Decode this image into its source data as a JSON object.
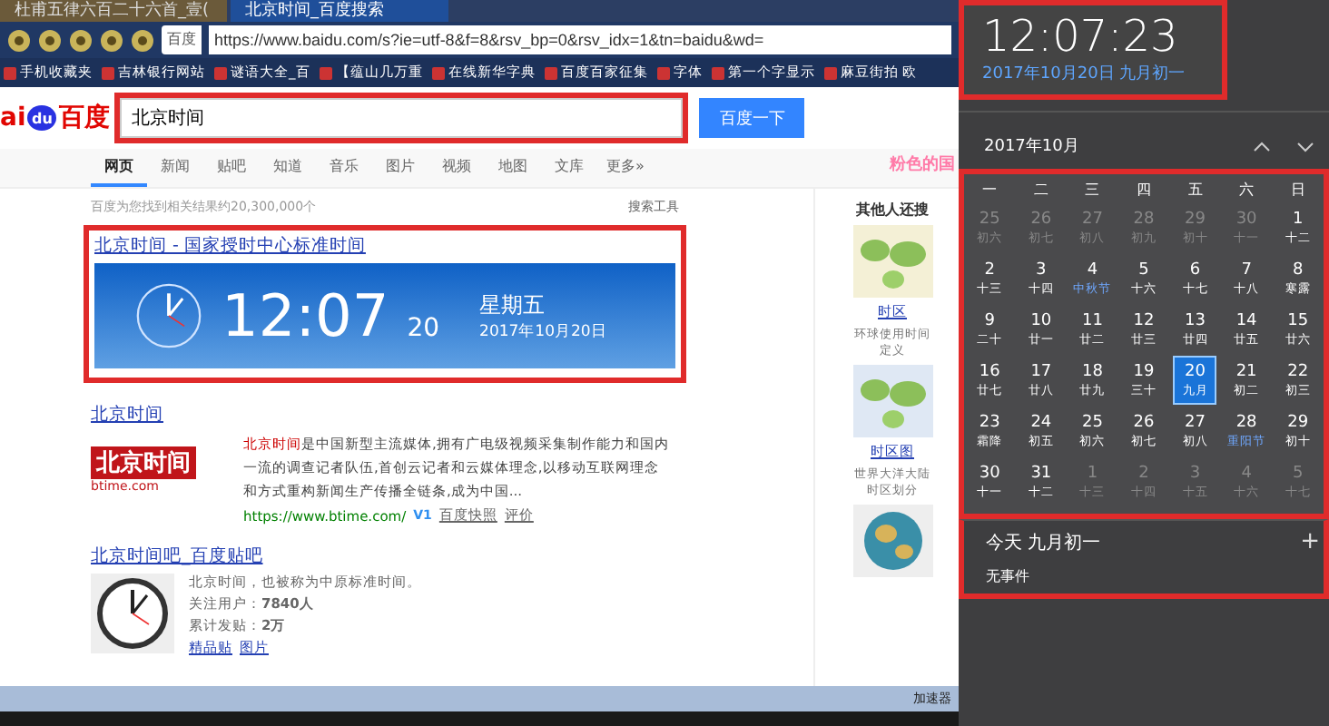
{
  "browser": {
    "tabs": [
      {
        "label": "杜甫五律六百二十六首_壹(",
        "selected": false
      },
      {
        "label": "北京时间_百度搜索",
        "selected": true
      }
    ],
    "address": {
      "site": "百度",
      "url": "https://www.baidu.com/s?ie=utf-8&f=8&rsv_bp=0&rsv_idx=1&tn=baidu&wd="
    },
    "bookmarks": [
      "手机收藏夹",
      "吉林银行网站",
      "谜语大全_百",
      "【蕴山几万重",
      "在线新华字典",
      "百度百家征集",
      "字体",
      "第一个字显示",
      "麻豆街拍 欧"
    ]
  },
  "search": {
    "logo_left": "ai",
    "logo_paw": "du",
    "logo_right": "百度",
    "value": "北京时间",
    "button": "百度一下"
  },
  "nav": [
    {
      "label": "网页",
      "selected": true
    },
    {
      "label": "新闻",
      "selected": false
    },
    {
      "label": "贴吧",
      "selected": false
    },
    {
      "label": "知道",
      "selected": false
    },
    {
      "label": "音乐",
      "selected": false
    },
    {
      "label": "图片",
      "selected": false
    },
    {
      "label": "视频",
      "selected": false
    },
    {
      "label": "地图",
      "selected": false
    },
    {
      "label": "文库",
      "selected": false
    },
    {
      "label": "更多»",
      "selected": false
    }
  ],
  "result_count": "百度为您找到相关结果约20,300,000个",
  "search_tools": "搜索工具",
  "time_result": {
    "title": "北京时间 - 国家授时中心标准时间",
    "time": "12:07",
    "seconds": "20",
    "weekday": "星期五",
    "date": "2017年10月20日"
  },
  "btime_result": {
    "title": "北京时间",
    "logo": "北京时间",
    "logo_domain": "btime.com",
    "highlight": "北京时间",
    "description": "是中国新型主流媒体,拥有广电级视频采集制作能力和国内一流的调查记者队伍,首创云记者和云媒体理念,以移动互联网理念和方式重构新闻生产传播全链条,成为中国...",
    "url": "https://www.btime.com/",
    "badge": "V1",
    "links": [
      "百度快照",
      "评价"
    ]
  },
  "tieba_result": {
    "title": "北京时间吧_百度贴吧",
    "description": "北京时间，也被称为中原标准时间。",
    "stats": [
      {
        "label": "关注用户：",
        "value": "7840人"
      },
      {
        "label": "累计发贴：",
        "value": "2万"
      }
    ],
    "links": [
      "精品贴",
      "图片"
    ]
  },
  "side": {
    "banner": "粉色的国",
    "heading": "其他人还搜",
    "items": [
      {
        "title": "时区",
        "caption": "环球使用时间定义"
      },
      {
        "title": "时区图",
        "caption": "世界大洋大陆时区划分"
      }
    ]
  },
  "status_bar": {
    "label": "加速器"
  },
  "calendar": {
    "time": "12:07:23",
    "date": "2017年10月20日 九月初一",
    "month": "2017年10月",
    "weekdays": [
      "一",
      "二",
      "三",
      "四",
      "五",
      "六",
      "日"
    ],
    "days": [
      {
        "day": "25",
        "lunar": "初六",
        "current": false,
        "selected": false,
        "festival": false
      },
      {
        "day": "26",
        "lunar": "初七",
        "current": false,
        "selected": false,
        "festival": false
      },
      {
        "day": "27",
        "lunar": "初八",
        "current": false,
        "selected": false,
        "festival": false
      },
      {
        "day": "28",
        "lunar": "初九",
        "current": false,
        "selected": false,
        "festival": false
      },
      {
        "day": "29",
        "lunar": "初十",
        "current": false,
        "selected": false,
        "festival": false
      },
      {
        "day": "30",
        "lunar": "十一",
        "current": false,
        "selected": false,
        "festival": false
      },
      {
        "day": "1",
        "lunar": "十二",
        "current": true,
        "selected": false,
        "festival": false
      },
      {
        "day": "2",
        "lunar": "十三",
        "current": true,
        "selected": false,
        "festival": false
      },
      {
        "day": "3",
        "lunar": "十四",
        "current": true,
        "selected": false,
        "festival": false
      },
      {
        "day": "4",
        "lunar": "中秋节",
        "current": true,
        "selected": false,
        "festival": true
      },
      {
        "day": "5",
        "lunar": "十六",
        "current": true,
        "selected": false,
        "festival": false
      },
      {
        "day": "6",
        "lunar": "十七",
        "current": true,
        "selected": false,
        "festival": false
      },
      {
        "day": "7",
        "lunar": "十八",
        "current": true,
        "selected": false,
        "festival": false
      },
      {
        "day": "8",
        "lunar": "寒露",
        "current": true,
        "selected": false,
        "festival": false
      },
      {
        "day": "9",
        "lunar": "二十",
        "current": true,
        "selected": false,
        "festival": false
      },
      {
        "day": "10",
        "lunar": "廿一",
        "current": true,
        "selected": false,
        "festival": false
      },
      {
        "day": "11",
        "lunar": "廿二",
        "current": true,
        "selected": false,
        "festival": false
      },
      {
        "day": "12",
        "lunar": "廿三",
        "current": true,
        "selected": false,
        "festival": false
      },
      {
        "day": "13",
        "lunar": "廿四",
        "current": true,
        "selected": false,
        "festival": false
      },
      {
        "day": "14",
        "lunar": "廿五",
        "current": true,
        "selected": false,
        "festival": false
      },
      {
        "day": "15",
        "lunar": "廿六",
        "current": true,
        "selected": false,
        "festival": false
      },
      {
        "day": "16",
        "lunar": "廿七",
        "current": true,
        "selected": false,
        "festival": false
      },
      {
        "day": "17",
        "lunar": "廿八",
        "current": true,
        "selected": false,
        "festival": false
      },
      {
        "day": "18",
        "lunar": "廿九",
        "current": true,
        "selected": false,
        "festival": false
      },
      {
        "day": "19",
        "lunar": "三十",
        "current": true,
        "selected": false,
        "festival": false
      },
      {
        "day": "20",
        "lunar": "九月",
        "current": true,
        "selected": true,
        "festival": false
      },
      {
        "day": "21",
        "lunar": "初二",
        "current": true,
        "selected": false,
        "festival": false
      },
      {
        "day": "22",
        "lunar": "初三",
        "current": true,
        "selected": false,
        "festival": false
      },
      {
        "day": "23",
        "lunar": "霜降",
        "current": true,
        "selected": false,
        "festival": false
      },
      {
        "day": "24",
        "lunar": "初五",
        "current": true,
        "selected": false,
        "festival": false
      },
      {
        "day": "25",
        "lunar": "初六",
        "current": true,
        "selected": false,
        "festival": false
      },
      {
        "day": "26",
        "lunar": "初七",
        "current": true,
        "selected": false,
        "festival": false
      },
      {
        "day": "27",
        "lunar": "初八",
        "current": true,
        "selected": false,
        "festival": false
      },
      {
        "day": "28",
        "lunar": "重阳节",
        "current": true,
        "selected": false,
        "festival": true
      },
      {
        "day": "29",
        "lunar": "初十",
        "current": true,
        "selected": false,
        "festival": false
      },
      {
        "day": "30",
        "lunar": "十一",
        "current": true,
        "selected": false,
        "festival": false
      },
      {
        "day": "31",
        "lunar": "十二",
        "current": true,
        "selected": false,
        "festival": false
      },
      {
        "day": "1",
        "lunar": "十三",
        "current": false,
        "selected": false,
        "festival": false
      },
      {
        "day": "2",
        "lunar": "十四",
        "current": false,
        "selected": false,
        "festival": false
      },
      {
        "day": "3",
        "lunar": "十五",
        "current": false,
        "selected": false,
        "festival": false
      },
      {
        "day": "4",
        "lunar": "十六",
        "current": false,
        "selected": false,
        "festival": false
      },
      {
        "day": "5",
        "lunar": "十七",
        "current": false,
        "selected": false,
        "festival": false
      }
    ],
    "today": "今天 九月初一",
    "add": "+",
    "events": "无事件"
  }
}
